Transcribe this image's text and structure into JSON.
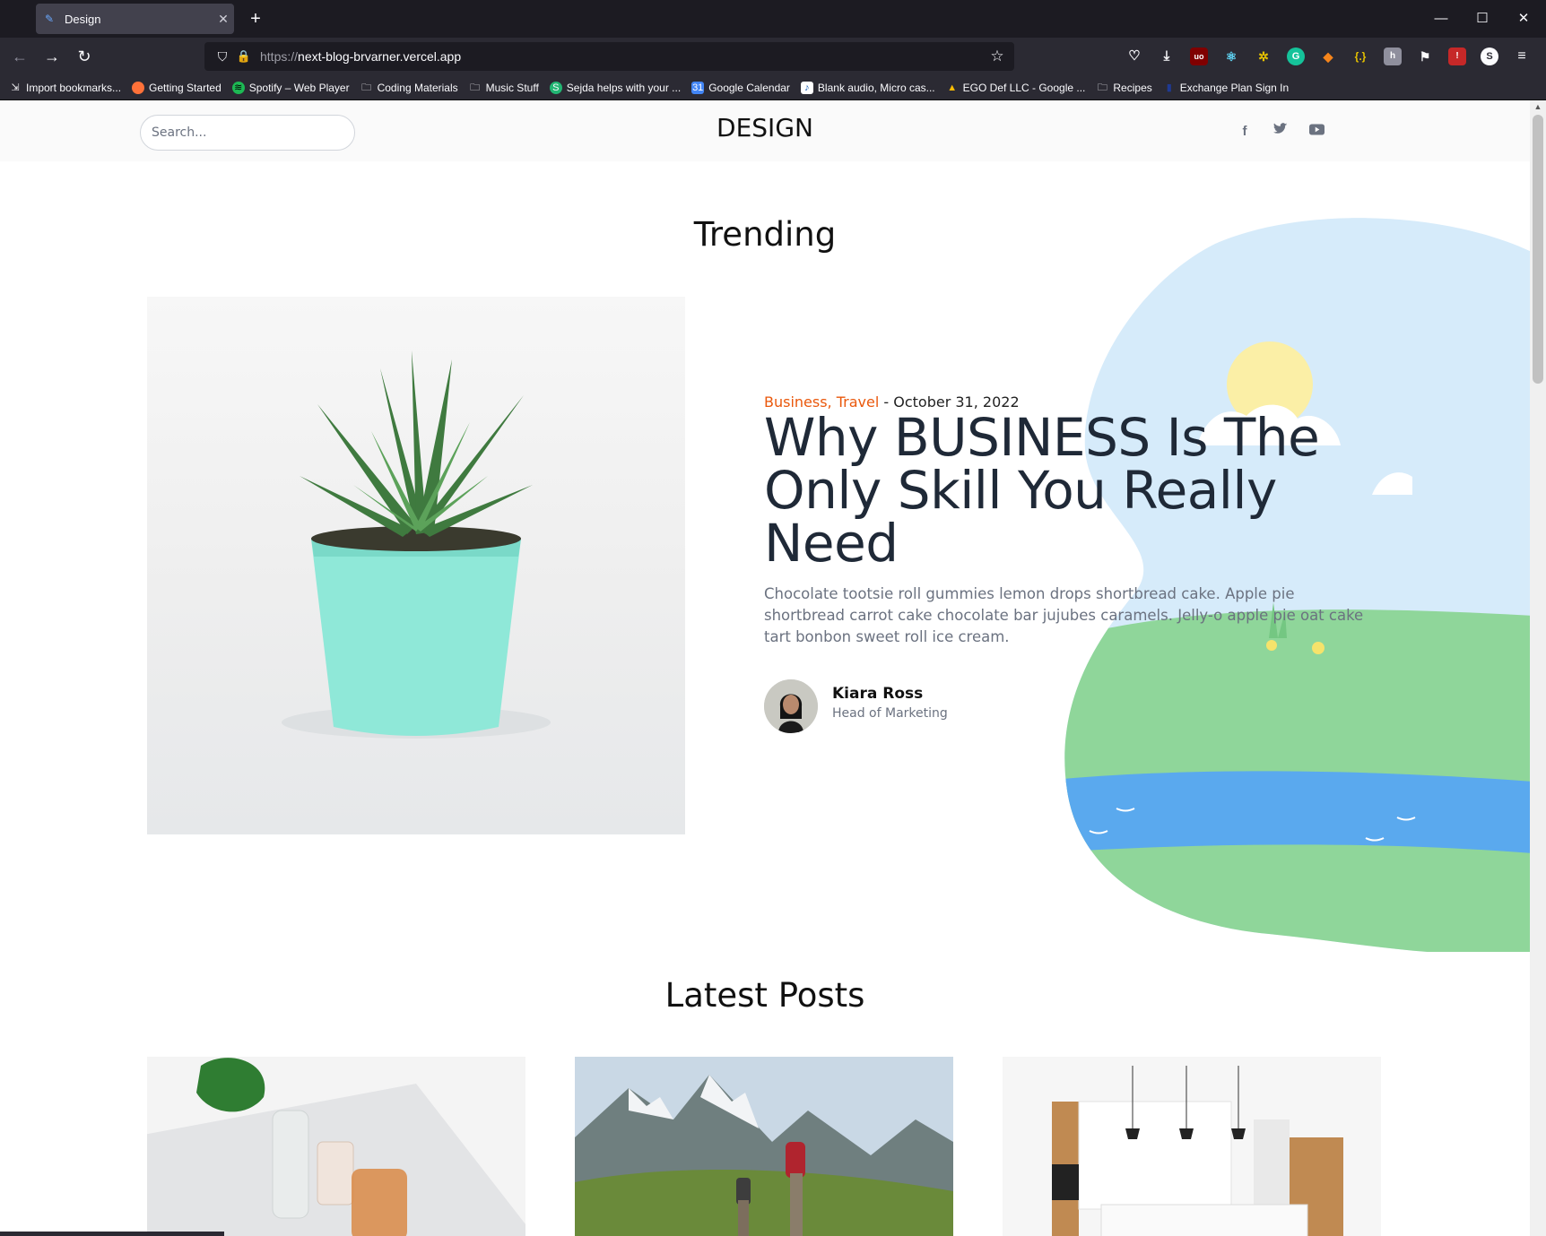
{
  "browser": {
    "tab_title": "Design",
    "tab_favicon": "brush-icon",
    "url_scheme": "https://",
    "url_host": "next-blog-brvarner.vercel.app",
    "bookmarks": [
      {
        "label": "Import bookmarks...",
        "icon": "import-icon"
      },
      {
        "label": "Getting Started",
        "icon": "firefox-icon"
      },
      {
        "label": "Spotify – Web Player",
        "icon": "spotify-icon"
      },
      {
        "label": "Coding Materials",
        "icon": "folder-icon"
      },
      {
        "label": "Music Stuff",
        "icon": "folder-icon"
      },
      {
        "label": "Sejda helps with your ...",
        "icon": "sejda-icon"
      },
      {
        "label": "Google Calendar",
        "icon": "calendar-icon"
      },
      {
        "label": "Blank audio, Micro cas...",
        "icon": "audio-icon"
      },
      {
        "label": "EGO Def LLC - Google ...",
        "icon": "drive-icon"
      },
      {
        "label": "Recipes",
        "icon": "folder-icon"
      },
      {
        "label": "Exchange Plan Sign In",
        "icon": "exchange-icon"
      }
    ],
    "colors": {
      "chrome_dark": "#1c1b22",
      "toolbar": "#2b2a33",
      "tab_active": "#42414d"
    }
  },
  "site": {
    "search_placeholder": "Search...",
    "logo": "DESIGN",
    "social": [
      "facebook-icon",
      "twitter-icon",
      "youtube-icon"
    ],
    "trending_heading": "Trending",
    "trending": {
      "categories": "Business, Travel",
      "separator": " - ",
      "date": "October 31, 2022",
      "title": "Why BUSINESS Is The Only Skill You Really Need",
      "excerpt": "Chocolate tootsie roll gummies lemon drops shortbread cake. Apple pie shortbread carrot cake chocolate bar jujubes caramels. Jelly-o apple pie oat cake tart bonbon sweet roll ice cream.",
      "author_name": "Kiara Ross",
      "author_role": "Head of Marketing"
    },
    "latest_heading": "Latest Posts",
    "colors": {
      "accent": "#ea580c",
      "headline": "#1f2937",
      "muted": "#6b7280"
    }
  }
}
